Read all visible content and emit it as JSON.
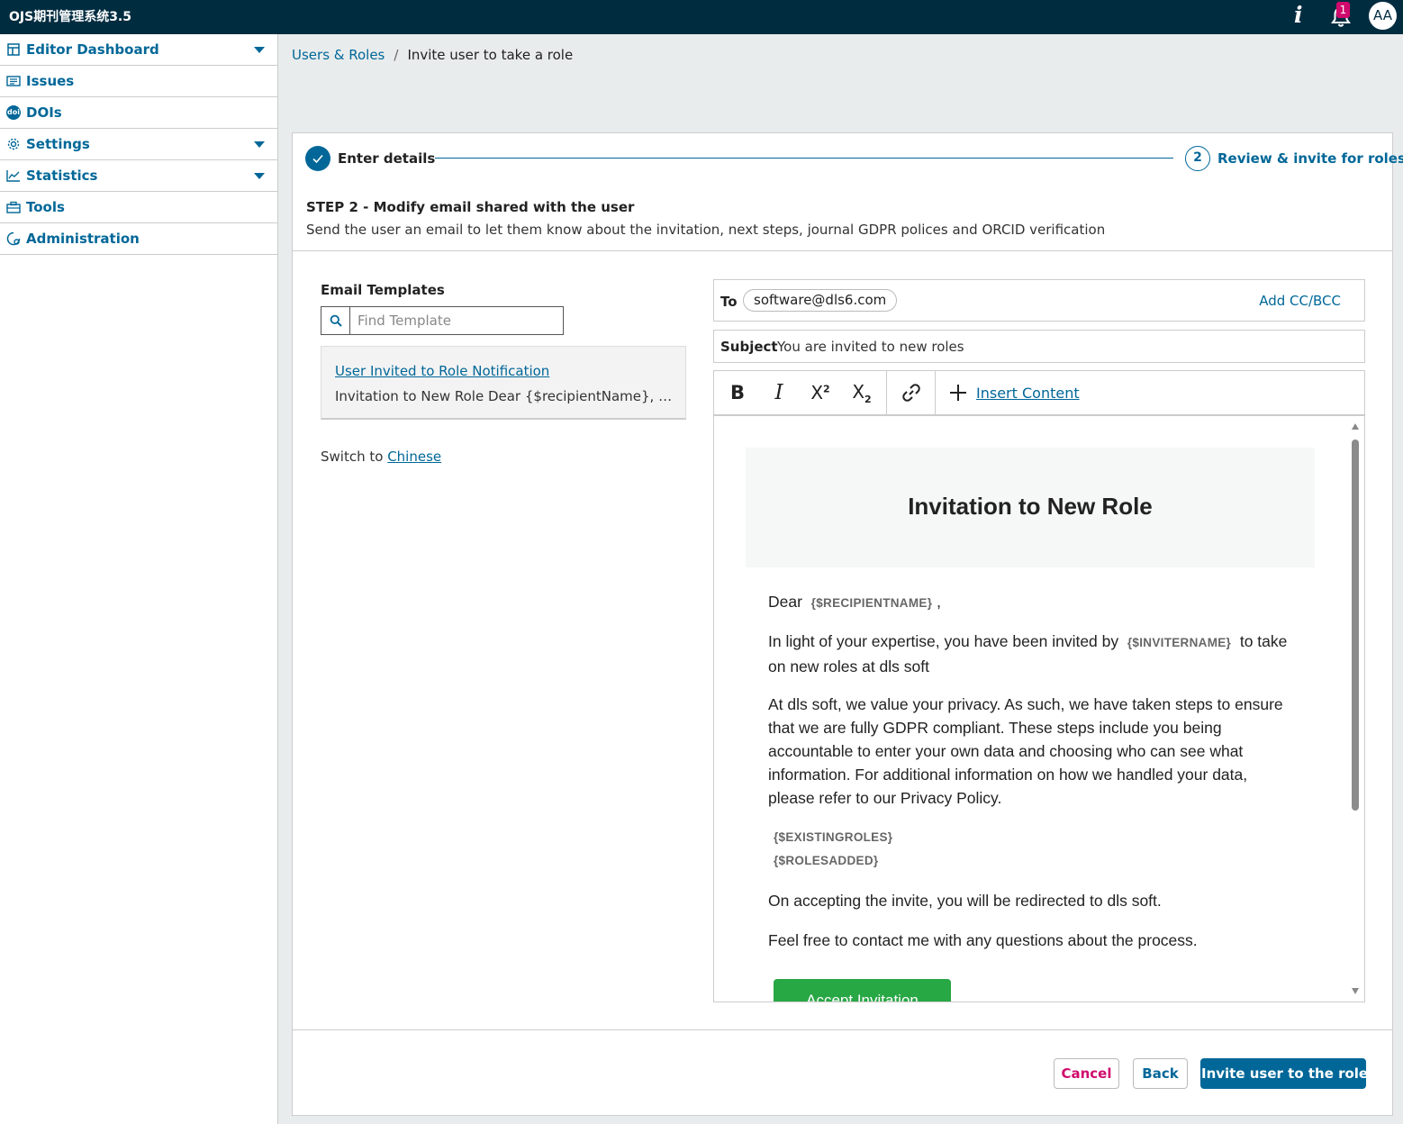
{
  "header": {
    "site_title": "OJS期刊管理系统3.5",
    "notification_count": "1",
    "avatar_initials": "AA"
  },
  "sidebar": {
    "items": [
      {
        "label": "Editor Dashboard",
        "icon": "dashboard-icon",
        "has_caret": true
      },
      {
        "label": "Issues",
        "icon": "issues-icon",
        "has_caret": false
      },
      {
        "label": "DOIs",
        "icon": "doi-icon",
        "badge_text": "doi",
        "has_caret": false
      },
      {
        "label": "Settings",
        "icon": "gear-icon",
        "has_caret": true
      },
      {
        "label": "Statistics",
        "icon": "chart-icon",
        "has_caret": true
      },
      {
        "label": "Tools",
        "icon": "toolbox-icon",
        "has_caret": false
      },
      {
        "label": "Administration",
        "icon": "admin-icon",
        "has_caret": false
      }
    ]
  },
  "breadcrumb": {
    "parent": "Users & Roles",
    "separator": "/",
    "current": "Invite user to take a role"
  },
  "steps": {
    "step1": "Enter details",
    "step2_number": "2",
    "step2": "Review & invite for roles"
  },
  "step_section": {
    "title": "STEP 2 - Modify email shared with the user",
    "description": "Send the user an email to let them know about the invitation, next steps, journal GDPR polices and ORCID verification"
  },
  "templates": {
    "heading": "Email Templates",
    "search_placeholder": "Find Template",
    "item_title": "User Invited to Role Notification",
    "item_preview": "Invitation to New Role Dear {$recipientName}, In light of your expertise",
    "switch_prefix": "Switch to",
    "switch_language": "Chinese"
  },
  "email": {
    "to_label": "To",
    "recipient": "software@dls6.com",
    "add_cc": "Add CC/BCC",
    "subject_label": "Subject",
    "subject": "You are invited to new roles",
    "insert_content": "Insert Content",
    "toolbar": {
      "bold": "B",
      "italic": "I",
      "superscript_base": "X",
      "superscript_mark": "2",
      "subscript_base": "X",
      "subscript_mark": "2"
    },
    "body": {
      "title": "Invitation to New Role",
      "dear": "Dear",
      "recipient_tag": "{$RECIPIENTNAME}",
      "dear_suffix": ",",
      "para1_before": "In light of your expertise, you have been invited by",
      "inviter_tag": "{$INVITERNAME}",
      "para1_after": "to take on new roles at dls soft",
      "para2": "At dls soft, we value your privacy. As such, we have taken steps to ensure that we are fully GDPR compliant. These steps include you being accountable to enter your own data and choosing who can see what information. For additional information on how we handled your data, please refer to our Privacy Policy.",
      "existing_roles_tag": "{$EXISTINGROLES}",
      "roles_added_tag": "{$ROLESADDED}",
      "para3": "On accepting the invite, you will be redirected to dls soft.",
      "para4": "Feel free to contact me with any questions about the process.",
      "accept_button": "Accept Invitation"
    }
  },
  "actions": {
    "cancel": "Cancel",
    "back": "Back",
    "invite": "Invite user to the role"
  },
  "colors": {
    "header_bg": "#002c40",
    "primary": "#006798",
    "cancel": "#d00a6c",
    "accept_green": "#28a745",
    "badge": "#d00a6c"
  }
}
